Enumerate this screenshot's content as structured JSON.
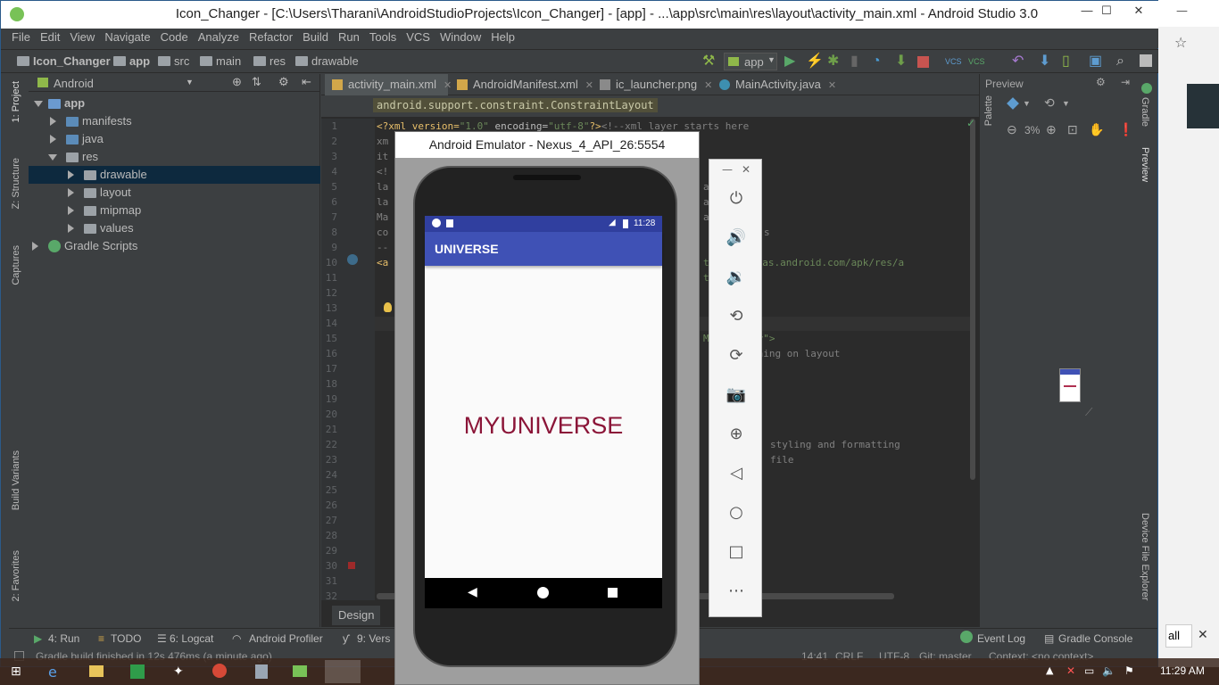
{
  "window": {
    "title": "Icon_Changer - [C:\\Users\\Tharani\\AndroidStudioProjects\\Icon_Changer] - [app] - ...\\app\\src\\main\\res\\layout\\activity_main.xml - Android Studio 3.0",
    "minimize": "—",
    "maximize": "☐",
    "close": "✕"
  },
  "menu": [
    "File",
    "Edit",
    "View",
    "Navigate",
    "Code",
    "Analyze",
    "Refactor",
    "Build",
    "Run",
    "Tools",
    "VCS",
    "Window",
    "Help"
  ],
  "navbar": {
    "crumbs": [
      "Icon_Changer",
      "app",
      "src",
      "main",
      "res",
      "drawable"
    ],
    "run_config": "app"
  },
  "left_tabs": [
    "1: Project",
    "Z: Structure",
    "Captures",
    "Build Variants",
    "2: Favorites"
  ],
  "project": {
    "view": "Android",
    "tree": [
      {
        "label": "app",
        "level": 0,
        "expanded": true,
        "bold": true
      },
      {
        "label": "manifests",
        "level": 1,
        "expanded": false
      },
      {
        "label": "java",
        "level": 1,
        "expanded": false
      },
      {
        "label": "res",
        "level": 1,
        "expanded": true
      },
      {
        "label": "drawable",
        "level": 2,
        "expanded": false,
        "selected": true
      },
      {
        "label": "layout",
        "level": 2,
        "expanded": false
      },
      {
        "label": "mipmap",
        "level": 2,
        "expanded": false
      },
      {
        "label": "values",
        "level": 2,
        "expanded": false
      },
      {
        "label": "Gradle Scripts",
        "level": 0,
        "expanded": false
      }
    ]
  },
  "editor": {
    "tabs": [
      {
        "label": "activity_main.xml",
        "active": true
      },
      {
        "label": "AndroidManifest.xml",
        "active": false
      },
      {
        "label": "ic_launcher.png",
        "active": false
      },
      {
        "label": "MainActivity.java",
        "active": false
      }
    ],
    "breadcrumb": "android.support.constraint.ConstraintLayout",
    "line_numbers": [
      "1",
      "2",
      "3",
      "4",
      "5",
      "6",
      "7",
      "8",
      "9",
      "10",
      "11",
      "12",
      "13",
      "14",
      "15",
      "16",
      "17",
      "18",
      "19",
      "20",
      "21",
      "22",
      "23",
      "24",
      "25",
      "26",
      "27",
      "28",
      "29",
      "30",
      "31",
      "32"
    ],
    "line1_a": "<?xml version=",
    "line1_b": "\"1.0\"",
    "line1_c": " encoding=",
    "line1_d": "\"utf-8\"",
    "line1_e": "?>",
    "line1_f": "<!--xml layer starts here",
    "left_frag": [
      "xm",
      "it",
      "<!",
      "la",
      "la",
      "Ma",
      "co",
      "--",
      "<a"
    ],
    "right_frag": {
      "l5": "a",
      "l6": "a",
      "l7": "a",
      "l8": "s",
      "l10": "tp://schemas.android.com/apk/res/a",
      "l11": "t",
      "l15_a": "M",
      "l15_b": "ty\">",
      "l16": "thing on layout",
      "l22": "styling and formatting",
      "l23": "file"
    },
    "design_tab": "Design"
  },
  "preview": {
    "title": "Preview",
    "zoom": "3%"
  },
  "right_tabs": [
    "Palette",
    "Gradle",
    "Preview",
    "Device File Explorer"
  ],
  "bottom_tools": [
    "4: Run",
    "TODO",
    "6: Logcat",
    "Android Profiler",
    "9: Vers",
    "Event Log",
    "Gradle Console"
  ],
  "status": {
    "message": "Gradle build finished in 12s 476ms (a minute ago)",
    "position": "14:41",
    "line_sep": "CRLF",
    "encoding": "UTF-8",
    "git": "Git: master",
    "context": "Context: <no context>"
  },
  "emulator": {
    "title": "Android Emulator - Nexus_4_API_26:5554",
    "clock": "11:28",
    "app_title": "UNIVERSE",
    "main_text": "MYUNIVERSE",
    "colors": {
      "statusbar": "#303f9f",
      "appbar": "#3f51b5",
      "text": "#8b1538"
    }
  },
  "taskbar": {
    "time": "11:29 AM"
  },
  "browser": {
    "fragment": "all"
  }
}
